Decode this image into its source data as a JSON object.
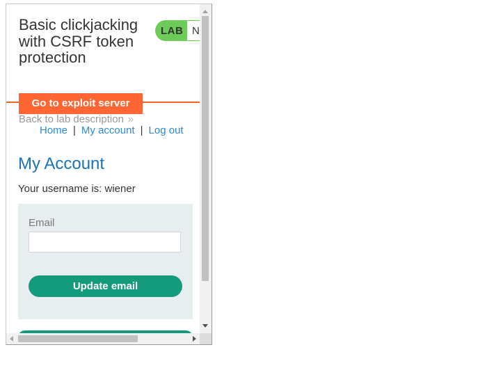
{
  "header": {
    "title": "Basic clickjacking with CSRF token protection",
    "lab_badge": "LAB",
    "lab_status": "N"
  },
  "exploit_button": "Go to exploit server",
  "back_link": {
    "label": "Back to lab description",
    "chevron": "»"
  },
  "nav": {
    "home": "Home",
    "separator": "|",
    "my_account": "My account",
    "log_out": "Log out"
  },
  "account": {
    "heading": "My Account",
    "username_text": "Your username is: wiener",
    "email_label": "Email",
    "email_value": "",
    "update_button": "Update email"
  },
  "colors": {
    "accent_orange": "#ff6633",
    "lab_green": "#6dcc59",
    "button_green": "#149b7b",
    "link_blue": "#2a8ad4",
    "heading_blue": "#1b74b5"
  }
}
